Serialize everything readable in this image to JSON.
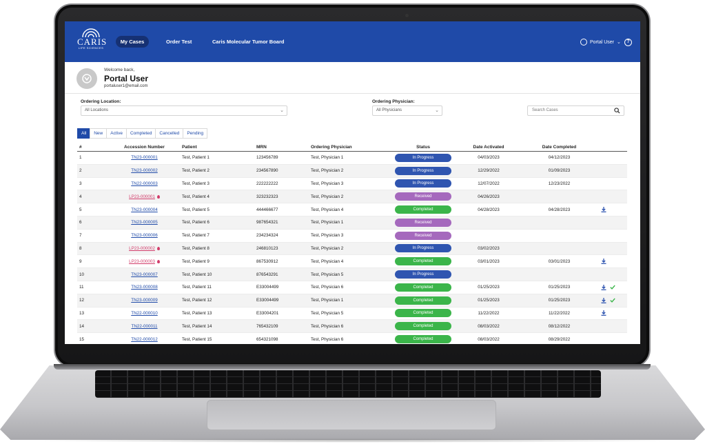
{
  "header": {
    "logo_text": "CARIS",
    "logo_sub": "LIFE SCIENCES",
    "nav": {
      "my_cases": "My Cases",
      "order_test": "Order Test",
      "tumor_board": "Caris Molecular Tumor Board"
    },
    "user_label": "Portal User",
    "help_glyph": "?"
  },
  "welcome": {
    "label": "Welcome back,",
    "name": "Portal User",
    "email": "portaluser1@email.com"
  },
  "filters": {
    "location_label": "Ordering Location:",
    "location_value": "All Locations",
    "physician_label": "Ordering Physician:",
    "physician_value": "All Physicians",
    "search_placeholder": "Search Cases"
  },
  "tabs": [
    "All",
    "New",
    "Active",
    "Completed",
    "Cancelled",
    "Pending"
  ],
  "table": {
    "headers": [
      "#",
      "Accession Number",
      "Patient",
      "MRN",
      "Ordering Physician",
      "Status",
      "Date Activated",
      "Date Completed"
    ],
    "rows": [
      {
        "num": "1",
        "acc": "TN23-000001",
        "lp": false,
        "patient": "Test, Patient 1",
        "mrn": "123456789",
        "physician": "Test, Physician 1",
        "status": "In Progress",
        "activated": "04/03/2023",
        "completed": "04/12/2023",
        "download": false,
        "check": false
      },
      {
        "num": "2",
        "acc": "TN23-000002",
        "lp": false,
        "patient": "Test, Patient 2",
        "mrn": "234567890",
        "physician": "Test, Physician 2",
        "status": "In Progress",
        "activated": "12/29/2022",
        "completed": "01/09/2023",
        "download": false,
        "check": false
      },
      {
        "num": "3",
        "acc": "TN22-000003",
        "lp": false,
        "patient": "Test, Patient 3",
        "mrn": "222222222",
        "physician": "Test, Physician 3",
        "status": "In Progress",
        "activated": "12/07/2022",
        "completed": "12/23/2022",
        "download": false,
        "check": false
      },
      {
        "num": "4",
        "acc": "LP23-000001",
        "lp": true,
        "patient": "Test, Patient 4",
        "mrn": "323232323",
        "physician": "Test, Physician 2",
        "status": "Received",
        "activated": "04/26/2023",
        "completed": "",
        "download": false,
        "check": false
      },
      {
        "num": "5",
        "acc": "TN23-000004",
        "lp": false,
        "patient": "Test, Patient 5",
        "mrn": "444466677",
        "physician": "Test, Physician 4",
        "status": "Completed",
        "activated": "04/28/2023",
        "completed": "04/28/2023",
        "download": true,
        "check": false
      },
      {
        "num": "6",
        "acc": "TN23-000005",
        "lp": false,
        "patient": "Test, Patient 6",
        "mrn": "987654321",
        "physician": "Test, Physician 1",
        "status": "Received",
        "activated": "",
        "completed": "",
        "download": false,
        "check": false
      },
      {
        "num": "7",
        "acc": "TN23-000006",
        "lp": false,
        "patient": "Test, Patient 7",
        "mrn": "234234324",
        "physician": "Test, Physician 3",
        "status": "Received",
        "activated": "",
        "completed": "",
        "download": false,
        "check": false
      },
      {
        "num": "8",
        "acc": "LP23-000002",
        "lp": true,
        "patient": "Test, Patient 8",
        "mrn": "246810123",
        "physician": "Test, Physician 2",
        "status": "In Progress",
        "activated": "03/02/2023",
        "completed": "",
        "download": false,
        "check": false
      },
      {
        "num": "9",
        "acc": "LP23-000003",
        "lp": true,
        "patient": "Test, Patient 9",
        "mrn": "867530912",
        "physician": "Test, Physician 4",
        "status": "Completed",
        "activated": "03/01/2023",
        "completed": "03/01/2023",
        "download": true,
        "check": false
      },
      {
        "num": "10",
        "acc": "TN23-000007",
        "lp": false,
        "patient": "Test, Patient 10",
        "mrn": "876543291",
        "physician": "Test, Physician 5",
        "status": "In Progress",
        "activated": "",
        "completed": "",
        "download": false,
        "check": false
      },
      {
        "num": "11",
        "acc": "TN23-000008",
        "lp": false,
        "patient": "Test, Patient 11",
        "mrn": "E33004499",
        "physician": "Test, Physician 6",
        "status": "Completed",
        "activated": "01/25/2023",
        "completed": "01/25/2023",
        "download": true,
        "check": true
      },
      {
        "num": "12",
        "acc": "TN23-000009",
        "lp": false,
        "patient": "Test, Patient 12",
        "mrn": "E33004499",
        "physician": "Test, Physician 1",
        "status": "Completed",
        "activated": "01/25/2023",
        "completed": "01/25/2023",
        "download": true,
        "check": true
      },
      {
        "num": "13",
        "acc": "TN22-000010",
        "lp": false,
        "patient": "Test, Patient 13",
        "mrn": "E33004201",
        "physician": "Test, Physician 5",
        "status": "Completed",
        "activated": "11/22/2022",
        "completed": "11/22/2022",
        "download": true,
        "check": false
      },
      {
        "num": "14",
        "acc": "TN22-000011",
        "lp": false,
        "patient": "Test, Patient 14",
        "mrn": "765432109",
        "physician": "Test, Physician 6",
        "status": "Completed",
        "activated": "08/03/2022",
        "completed": "08/12/2022",
        "download": false,
        "check": false
      },
      {
        "num": "15",
        "acc": "TN22-000012",
        "lp": false,
        "patient": "Test, Patient 15",
        "mrn": "654321098",
        "physician": "Test, Physician 6",
        "status": "Completed",
        "activated": "08/03/2022",
        "completed": "08/29/2022",
        "download": false,
        "check": false
      }
    ]
  },
  "colors": {
    "brand_blue": "#1f4aa8",
    "in_progress": "#2f55b0",
    "received": "#a569bd",
    "completed": "#3bb54a",
    "lp_link": "#d23c6a"
  }
}
